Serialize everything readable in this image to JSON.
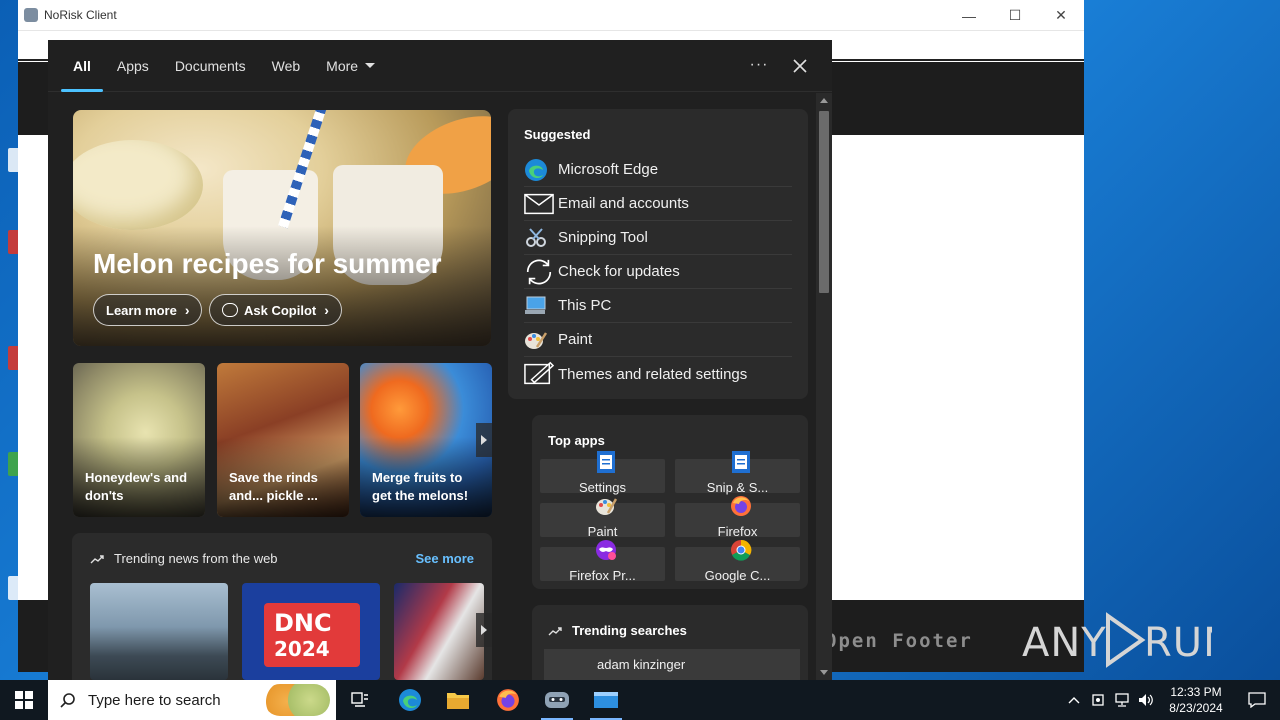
{
  "app_window": {
    "title": "NoRisk Client",
    "footer_text": "Open Footer",
    "watermark": "ANY RUN"
  },
  "search_flyout": {
    "tabs": [
      {
        "label": "All",
        "active": true
      },
      {
        "label": "Apps"
      },
      {
        "label": "Documents"
      },
      {
        "label": "Web"
      },
      {
        "label": "More"
      }
    ],
    "hero": {
      "title": "Melon recipes for summer",
      "learn_more": "Learn more",
      "ask_copilot": "Ask Copilot"
    },
    "story_cards": [
      {
        "title": "Honeydew's and don'ts"
      },
      {
        "title": "Save the rinds and... pickle ..."
      },
      {
        "title": "Merge fruits to get the melons!"
      }
    ],
    "trending_news": {
      "heading": "Trending news from the web",
      "see_more": "See more",
      "dnc_text_1": "DNC",
      "dnc_text_2": "2024"
    },
    "suggested": {
      "heading": "Suggested",
      "items": [
        {
          "label": "Microsoft Edge",
          "icon": "edge-icon"
        },
        {
          "label": "Email and accounts",
          "icon": "mail-icon"
        },
        {
          "label": "Snipping Tool",
          "icon": "snipping-tool-icon"
        },
        {
          "label": "Check for updates",
          "icon": "sync-icon"
        },
        {
          "label": "This PC",
          "icon": "computer-icon"
        },
        {
          "label": "Paint",
          "icon": "paint-icon"
        },
        {
          "label": "Themes and related settings",
          "icon": "themes-icon"
        }
      ]
    },
    "top_apps": {
      "heading": "Top apps",
      "apps": [
        {
          "label": "Settings",
          "icon": "document-icon"
        },
        {
          "label": "Snip & S...",
          "icon": "document-icon"
        },
        {
          "label": "Paint",
          "icon": "paint-icon"
        },
        {
          "label": "Firefox",
          "icon": "firefox-icon"
        },
        {
          "label": "Firefox Pr...",
          "icon": "firefox-private-icon"
        },
        {
          "label": "Google C...",
          "icon": "chrome-icon"
        }
      ]
    },
    "trending_searches": {
      "heading": "Trending searches",
      "items": [
        "adam kinzinger"
      ]
    }
  },
  "taskbar": {
    "search_placeholder": "Type here to search",
    "time": "12:33 PM",
    "date": "8/23/2024"
  },
  "colors": {
    "accent": "#4cc2ff",
    "link": "#68c0ff",
    "panel_bg": "#202020",
    "card_bg": "#2b2b2b"
  }
}
